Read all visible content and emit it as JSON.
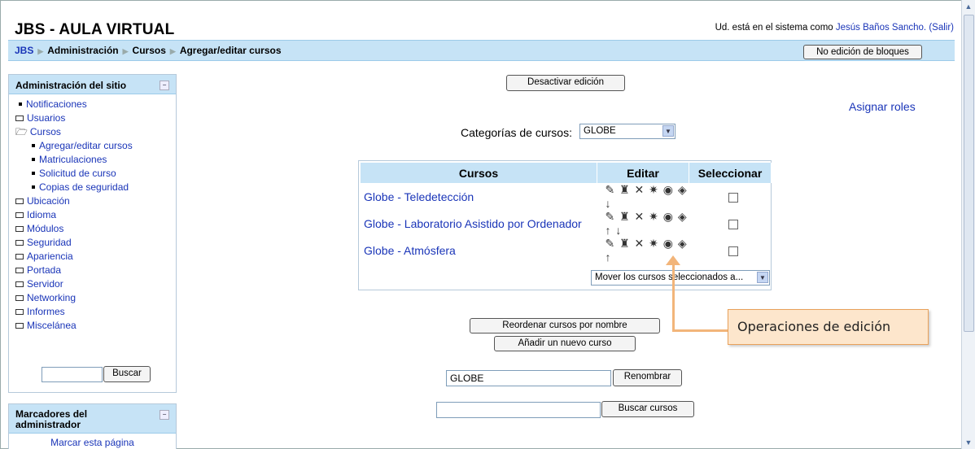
{
  "site": {
    "title": "JBS - AULA VIRTUAL"
  },
  "login": {
    "prefix": "Ud. está en el sistema como ",
    "user": "Jesús Baños Sancho.",
    "logout": "(Salir)"
  },
  "breadcrumb": [
    "JBS",
    "Administración",
    "Cursos",
    "Agregar/editar cursos"
  ],
  "header_button": "No edición de bloques",
  "admin_block": {
    "title": "Administración del sitio",
    "items": [
      {
        "label": "Notificaciones",
        "type": "bullet"
      },
      {
        "label": "Usuarios",
        "type": "folder"
      },
      {
        "label": "Cursos",
        "type": "folder-open"
      },
      {
        "label": "Agregar/editar cursos",
        "type": "bullet-sub"
      },
      {
        "label": "Matriculaciones",
        "type": "bullet-sub"
      },
      {
        "label": "Solicitud de curso",
        "type": "bullet-sub"
      },
      {
        "label": "Copias de seguridad",
        "type": "bullet-sub"
      },
      {
        "label": "Ubicación",
        "type": "folder"
      },
      {
        "label": "Idioma",
        "type": "folder"
      },
      {
        "label": "Módulos",
        "type": "folder"
      },
      {
        "label": "Seguridad",
        "type": "folder"
      },
      {
        "label": "Apariencia",
        "type": "folder"
      },
      {
        "label": "Portada",
        "type": "folder"
      },
      {
        "label": "Servidor",
        "type": "folder"
      },
      {
        "label": "Networking",
        "type": "folder"
      },
      {
        "label": "Informes",
        "type": "folder"
      },
      {
        "label": "Miscelánea",
        "type": "folder"
      }
    ],
    "search_button": "Buscar"
  },
  "bookmarks_block": {
    "title": "Marcadores del administrador",
    "link": "Marcar esta página"
  },
  "main": {
    "deactivate_edit": "Desactivar edición",
    "assign_roles": "Asignar roles",
    "category_label": "Categorías de cursos:",
    "category_value": "GLOBE",
    "table_headers": [
      "Cursos",
      "Editar",
      "Seleccionar"
    ],
    "courses": [
      {
        "name": "Globe - Teledetección",
        "icons": "✎ ♜ ✕ ✷ ◉ ◈   ↓"
      },
      {
        "name": "Globe - Laboratorio Asistido por Ordenador",
        "icons": "✎ ♜ ✕ ✷ ◉ ◈ ↑ ↓"
      },
      {
        "name": "Globe - Atmósfera",
        "icons": "✎ ♜ ✕ ✷ ◉ ◈ ↑"
      }
    ],
    "move_select": "Mover los cursos seleccionados a...",
    "reorder_button": "Reordenar cursos por nombre",
    "add_button": "Añadir un nuevo curso",
    "rename_value": "GLOBE",
    "rename_button": "Renombrar",
    "search_courses_button": "Buscar cursos"
  },
  "callout": {
    "text": "Operaciones de edición"
  }
}
